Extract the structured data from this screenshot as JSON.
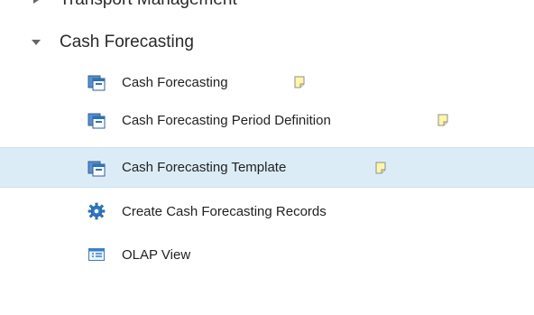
{
  "tree": {
    "partial_item": {
      "label": "Transport Management"
    },
    "group": {
      "label": "Cash Forecasting",
      "expanded": true,
      "items": [
        {
          "label": "Cash Forecasting",
          "icon": "form-window-icon",
          "note_icon": "note-icon"
        },
        {
          "label": "Cash Forecasting Period Definition",
          "icon": "form-window-icon",
          "note_icon": "note-icon"
        },
        {
          "label": "Cash Forecasting Template",
          "icon": "form-window-icon",
          "note_icon": "note-icon",
          "selected": true
        },
        {
          "label": "Create Cash Forecasting Records",
          "icon": "gear-icon"
        },
        {
          "label": "OLAP View",
          "icon": "olap-view-icon"
        }
      ]
    }
  },
  "colors": {
    "selection": "#dcecf7",
    "icon_blue": "#2e72b8",
    "note_yellow": "#fff6a8"
  }
}
